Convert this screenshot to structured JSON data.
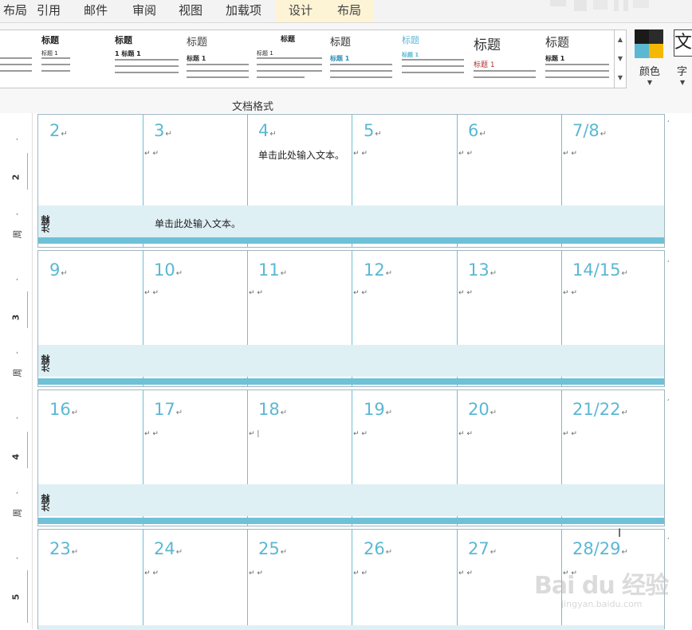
{
  "ribbon": {
    "tabs": [
      "布局",
      "引用",
      "邮件",
      "审阅",
      "视图",
      "加载项",
      "设计",
      "布局"
    ],
    "group_label": "文档格式",
    "styles": [
      {
        "title": "标题",
        "heading": "标题 1"
      },
      {
        "title": "标题",
        "heading": "1 标题 1"
      },
      {
        "title": "标题",
        "heading": "标题 1"
      },
      {
        "title": "标题",
        "heading": "标题 1"
      },
      {
        "title": "标题",
        "heading": "标题 1"
      },
      {
        "title": "标题",
        "heading": "标题 1"
      },
      {
        "title": "标题",
        "heading": "标题 1"
      },
      {
        "title": "标题",
        "heading": "标题 1"
      }
    ],
    "colors_label": "颜色",
    "fonts_label": "字",
    "fonts_glyph": "文"
  },
  "calendar": {
    "week_word": "周",
    "notes_label": "注释",
    "prompt_text": "单击此处输入文本。",
    "weeks": [
      {
        "number": "2",
        "days": [
          "2",
          "3",
          "4",
          "5",
          "6",
          "7/8"
        ]
      },
      {
        "number": "3",
        "days": [
          "9",
          "10",
          "11",
          "12",
          "13",
          "14/15"
        ]
      },
      {
        "number": "4",
        "days": [
          "16",
          "17",
          "18",
          "19",
          "20",
          "21/22"
        ]
      },
      {
        "number": "5",
        "days": [
          "23",
          "24",
          "25",
          "26",
          "27",
          "28/29"
        ]
      }
    ]
  },
  "watermark": {
    "logo": "Bai du 经验",
    "url": "jingyan.baidu.com"
  },
  "colors": {
    "accent": "#5bb8d3",
    "notes_bg": "#dff0f5",
    "band": "#6ec1d7",
    "ctx_tab": "#fdf3d5"
  }
}
